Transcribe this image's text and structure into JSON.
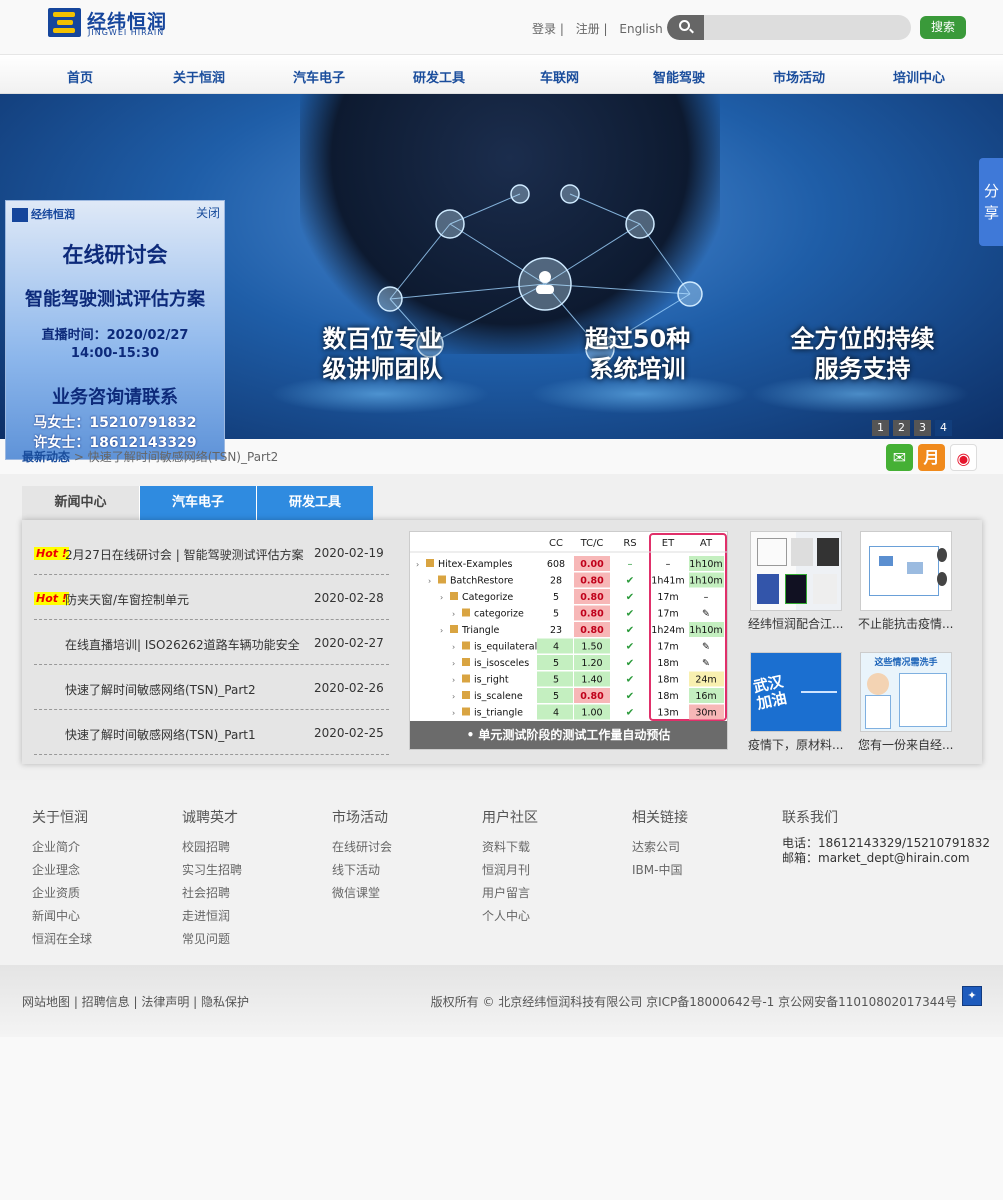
{
  "header": {
    "logo_cn": "经纬恒润",
    "logo_en": "JINGWEI HIRAIN",
    "links": [
      "登录 |",
      "注册 |",
      "English"
    ],
    "search_placeholder": "",
    "search_button": "搜索"
  },
  "nav": [
    "首页",
    "关于恒润",
    "汽车电子",
    "研发工具",
    "车联网",
    "智能驾驶",
    "市场活动",
    "培训中心"
  ],
  "banner": {
    "texts": [
      {
        "l1": "数百位专业",
        "l2": "级讲师团队"
      },
      {
        "l1": "超过50种",
        "l2": "系统培训"
      },
      {
        "l1": "全方位的持续",
        "l2": "服务支持"
      }
    ],
    "pages": [
      "1",
      "2",
      "3",
      "4"
    ],
    "active_page": 4,
    "share_label": "分享"
  },
  "popup": {
    "logo": "经纬恒润",
    "close": "关闭",
    "title": "在线研讨会",
    "subtitle": "智能驾驶测试评估方案",
    "time_label": "直播时间：2020/02/27",
    "time_range": "14:00-15:30",
    "contact_title": "业务咨询请联系",
    "contact1": "马女士：15210791832",
    "contact2": "许女士：18612143329"
  },
  "breadcrumb": {
    "home": "最新动态",
    "current": "快速了解时间敏感网络(TSN)_Part2"
  },
  "social": [
    "wechat-icon",
    "monthly-icon",
    "weibo-icon"
  ],
  "tabs": [
    "新闻中心",
    "汽车电子",
    "研发工具"
  ],
  "news": [
    {
      "hot": true,
      "title": "2月27日在线研讨会 | 智能驾驶测试评估方案",
      "date": "2020-02-19"
    },
    {
      "hot": true,
      "title": "防夹天窗/车窗控制单元",
      "date": "2020-02-28"
    },
    {
      "hot": false,
      "title": "在线直播培训| ISO26262道路车辆功能安全",
      "date": "2020-02-27"
    },
    {
      "hot": false,
      "title": "快速了解时间敏感网络(TSN)_Part2",
      "date": "2020-02-26"
    },
    {
      "hot": false,
      "title": "快速了解时间敏感网络(TSN)_Part1",
      "date": "2020-02-25"
    }
  ],
  "hot_label": "Hot !",
  "feature": {
    "caption": "• 单元测试阶段的测试工作量自动预估",
    "columns": [
      "CC",
      "TC/C",
      "RS",
      "ET",
      "AT"
    ],
    "rows": [
      {
        "name": "Hitex-Examples",
        "cc": "608",
        "tcc": "0.00",
        "rs": "–",
        "et": "–",
        "at": "1h10m"
      },
      {
        "name": "BatchRestore",
        "cc": "28",
        "tcc": "0.80",
        "rs": "✔",
        "et": "1h41m",
        "at": "1h10m"
      },
      {
        "name": "Categorize",
        "cc": "5",
        "tcc": "0.80",
        "rs": "✔",
        "et": "17m",
        "at": "–"
      },
      {
        "name": "categorize",
        "cc": "5",
        "tcc": "0.80",
        "rs": "✔",
        "et": "17m",
        "at": "✎"
      },
      {
        "name": "Triangle",
        "cc": "23",
        "tcc": "0.80",
        "rs": "✔",
        "et": "1h24m",
        "at": "1h10m"
      },
      {
        "name": "is_equilateral",
        "cc": "4",
        "tcc": "1.50",
        "rs": "✔",
        "et": "17m",
        "at": "✎"
      },
      {
        "name": "is_isosceles",
        "cc": "5",
        "tcc": "1.20",
        "rs": "✔",
        "et": "18m",
        "at": "✎"
      },
      {
        "name": "is_right",
        "cc": "5",
        "tcc": "1.40",
        "rs": "✔",
        "et": "18m",
        "at": "24m"
      },
      {
        "name": "is_scalene",
        "cc": "5",
        "tcc": "0.80",
        "rs": "✔",
        "et": "18m",
        "at": "16m"
      },
      {
        "name": "is_triangle",
        "cc": "4",
        "tcc": "1.00",
        "rs": "✔",
        "et": "13m",
        "at": "30m"
      }
    ]
  },
  "thumbs": [
    {
      "caption": "经纬恒润配合江...",
      "img_text": ""
    },
    {
      "caption": "不止能抗击疫情...",
      "img_text": ""
    },
    {
      "caption": "疫情下，原材料...",
      "img_text": "武汉加油"
    },
    {
      "caption": "您有一份来自经...",
      "img_text": "这些情况需洗手"
    }
  ],
  "footer": {
    "cols": [
      {
        "title": "关于恒润",
        "items": [
          "企业简介",
          "企业理念",
          "企业资质",
          "新闻中心",
          "恒润在全球"
        ]
      },
      {
        "title": "诚聘英才",
        "items": [
          "校园招聘",
          "实习生招聘",
          "社会招聘",
          "走进恒润",
          "常见问题"
        ]
      },
      {
        "title": "市场活动",
        "items": [
          "在线研讨会",
          "线下活动",
          "微信课堂"
        ]
      },
      {
        "title": "用户社区",
        "items": [
          "资料下载",
          "恒润月刊",
          "用户留言",
          "个人中心"
        ]
      },
      {
        "title": "相关链接",
        "items": [
          "达索公司",
          "IBM-中国"
        ]
      }
    ],
    "contact": {
      "title": "联系我们",
      "phone": "电话：18612143329/15210791832",
      "email": "邮箱：market_dept@hirain.com"
    }
  },
  "bottom": {
    "links": "网站地图 | 招聘信息 | 法律声明 | 隐私保护",
    "copyright": "版权所有 © 北京经纬恒润科技有限公司 京ICP备18000642号-1 京公网安备11010802017344号"
  },
  "colors": {
    "brand": "#16469c",
    "accent": "#2f8be0",
    "search_button": "#3a9a3a"
  }
}
